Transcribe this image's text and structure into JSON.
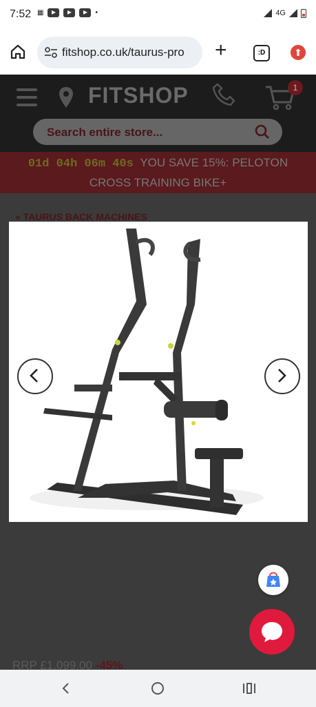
{
  "status_bar": {
    "time": "7:52",
    "network": "4G"
  },
  "browser": {
    "url": "fitshop.co.uk/taurus-pro",
    "tabs_icon": ":D"
  },
  "header": {
    "logo": "FITSHOP",
    "cart_count": "1",
    "search_placeholder": "Search entire store..."
  },
  "promo": {
    "timer": "01d 04h 06m 40s",
    "text1": "YOU SAVE 15%: PELOTON",
    "text2": "CROSS TRAINING BIKE+"
  },
  "breadcrumb": "« TAURUS BACK MACHINES",
  "price": {
    "rrp": "RRP £1,099.00",
    "discount": "-45%"
  },
  "colors": {
    "brand_red": "#e01a3c",
    "promo_bg": "#5a1a1e",
    "timer_yellow": "#d4c623"
  }
}
